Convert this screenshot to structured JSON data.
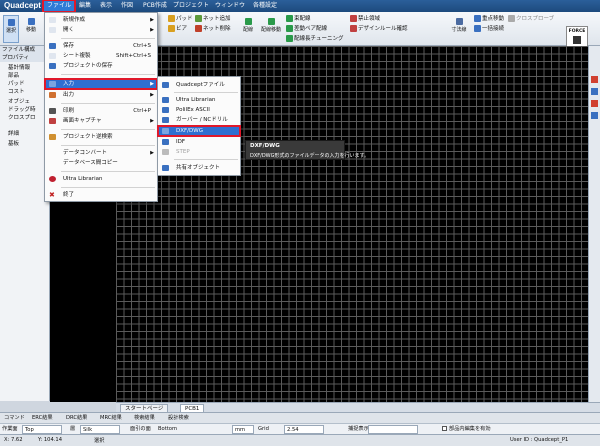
{
  "app": {
    "title": "Quadcept"
  },
  "menubar": [
    {
      "label": "ファイル",
      "active": true
    },
    {
      "label": "編集"
    },
    {
      "label": "表示"
    },
    {
      "label": "作図"
    },
    {
      "label": "PCB作成"
    },
    {
      "label": "プロジェクト"
    },
    {
      "label": "ウィンドウ"
    },
    {
      "label": "各種設定"
    }
  ],
  "toolbar": {
    "select": "選択",
    "move": "移動",
    "pad": "パッド",
    "via": "ビア",
    "net_add": "ネット追加",
    "net_delete": "ネット削除",
    "wiring": "配線",
    "wire_move": "配線移動",
    "bus_wiring": "束配線",
    "diff_pair": "差動ペア配線",
    "length_tuning": "配線長チューニング",
    "keepout": "禁止領域",
    "design_rule": "デザインルール確認",
    "dimension": "寸法線",
    "point_move": "重点移動",
    "batch_wire": "一括接続",
    "cross_probe": "クロスプローブ",
    "force": "FORCE"
  },
  "left_panel": {
    "tabs": [
      "ファイル構成",
      "プロパティ"
    ],
    "items": [
      "基計情報",
      "部品",
      "パッド",
      "コスト",
      "オブジェ",
      "ドラッグ時",
      "クロスプロ",
      "詳細",
      "基板"
    ]
  },
  "file_menu": {
    "items": [
      {
        "label": "新規作成",
        "shortcut": "",
        "submenu": true
      },
      {
        "label": "開く",
        "shortcut": "",
        "submenu": true
      },
      {
        "label": "保存",
        "shortcut": "Ctrl+S"
      },
      {
        "label": "シート複製",
        "shortcut": "Shift+Ctrl+S"
      },
      {
        "label": "プロジェクトの保存",
        "shortcut": ""
      },
      {
        "label": "入力",
        "shortcut": "",
        "submenu": true,
        "highlighted": true
      },
      {
        "label": "出力",
        "shortcut": "",
        "submenu": true
      },
      {
        "label": "印刷",
        "shortcut": "Ctrl+P"
      },
      {
        "label": "画面キャプチャ",
        "shortcut": "",
        "submenu": true
      },
      {
        "label": "プロジェクト逆検索",
        "shortcut": ""
      },
      {
        "label": "データコンバート",
        "shortcut": "",
        "submenu": true
      },
      {
        "label": "データベース間コピー",
        "shortcut": ""
      },
      {
        "label": "Ultra Librarian",
        "shortcut": ""
      },
      {
        "label": "終了",
        "shortcut": ""
      }
    ]
  },
  "input_submenu": {
    "items": [
      {
        "label": "Quadceptファイル"
      },
      {
        "label": "Ultra Librarian"
      },
      {
        "label": "PolilEx ASCII"
      },
      {
        "label": "ガーバー / NCドリル"
      },
      {
        "label": "DXF/DWG",
        "highlighted": true
      },
      {
        "label": "IDF"
      },
      {
        "label": "STEP",
        "disabled": true
      },
      {
        "label": "共有オブジェクト"
      }
    ]
  },
  "tooltip": {
    "title": "DXF/DWG",
    "text": "DXF/DWG形式のファイルデータの入力を行います。"
  },
  "doc_tabs": [
    {
      "label": "スタートページ"
    },
    {
      "label": "PCB1",
      "active": true
    }
  ],
  "bottom_tabs": [
    "コマンド",
    "ERC結果",
    "DRC結果",
    "MRC結果",
    "検索結果",
    "設計検索"
  ],
  "options_bar": {
    "work_layer_label": "作業面",
    "work_layer_value": "Top",
    "layer_label": "層",
    "layer_value": "Silk",
    "face_label": "面引の面",
    "face_value": "Bottom",
    "unit_value": "mm",
    "grid_label": "Grid",
    "grid_value": "2.54",
    "snap_label": "捕捉表示",
    "component_edit_label": "部品内編集を有効"
  },
  "status": {
    "x": "X: 7.62",
    "y": "Y: 104.14",
    "mode": "選択",
    "user": "User ID : Quadcept_P1"
  }
}
